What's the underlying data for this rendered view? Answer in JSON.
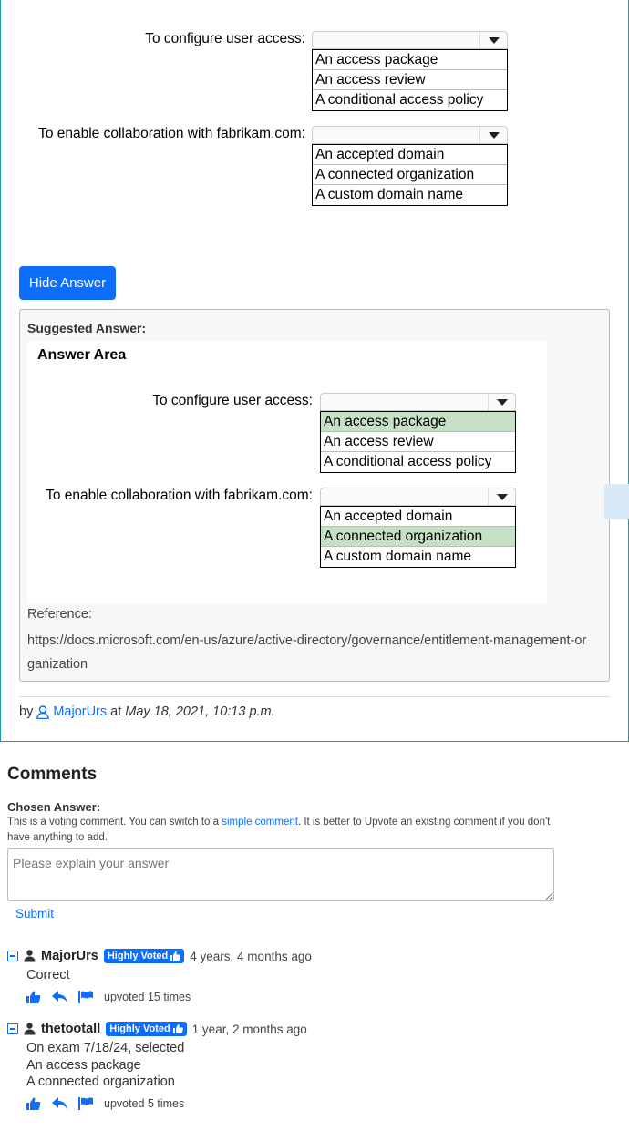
{
  "question": {
    "row1_label": "To configure user access:",
    "row1_options": [
      "An access package",
      "An access review",
      "A conditional access policy"
    ],
    "row2_label": "To enable collaboration with fabrikam.com:",
    "row2_options": [
      "An accepted domain",
      "A connected organization",
      "A custom domain name"
    ]
  },
  "hide_answer_button": "Hide Answer",
  "suggested": {
    "title": "Suggested Answer:",
    "area_title": "Answer Area",
    "row1_label": "To configure user access:",
    "row1_options": [
      "An access package",
      "An access review",
      "A conditional access policy"
    ],
    "row1_selected": "An access package",
    "row2_label": "To enable collaboration with fabrikam.com:",
    "row2_options": [
      "An accepted domain",
      "A connected organization",
      "A custom domain name"
    ],
    "row2_selected": "A connected organization",
    "reference_label": "Reference:",
    "reference_url": "https://docs.microsoft.com/en-us/azure/active-directory/governance/entitlement-management-organization"
  },
  "byline": {
    "by": "by",
    "user": "MajorUrs",
    "at": "at",
    "date": "May 18, 2021, 10:13 p.m."
  },
  "comments": {
    "heading": "Comments",
    "chosen_answer_label": "Chosen Answer:",
    "note_before": "This is a voting comment. You can switch to a ",
    "note_link": "simple comment",
    "note_after": ". It is better to Upvote an existing comment if you don't have anything to add.",
    "input_placeholder": "Please explain your answer",
    "submit_label": "Submit",
    "items": [
      {
        "user": "MajorUrs",
        "badge": "Highly Voted",
        "time": "4 years, 4 months ago",
        "lines": [
          "Correct"
        ],
        "upvotes": "upvoted 15 times"
      },
      {
        "user": "thetootall",
        "badge": "Highly Voted",
        "time": "1 year, 2 months ago",
        "lines": [
          "On exam 7/18/24, selected",
          "An access package",
          "A connected organization"
        ],
        "upvotes": "upvoted 5 times"
      }
    ]
  },
  "colors": {
    "accent": "#0d6efd",
    "selected_option": "#c6e0c6",
    "card_border": "#1a9aa8"
  }
}
